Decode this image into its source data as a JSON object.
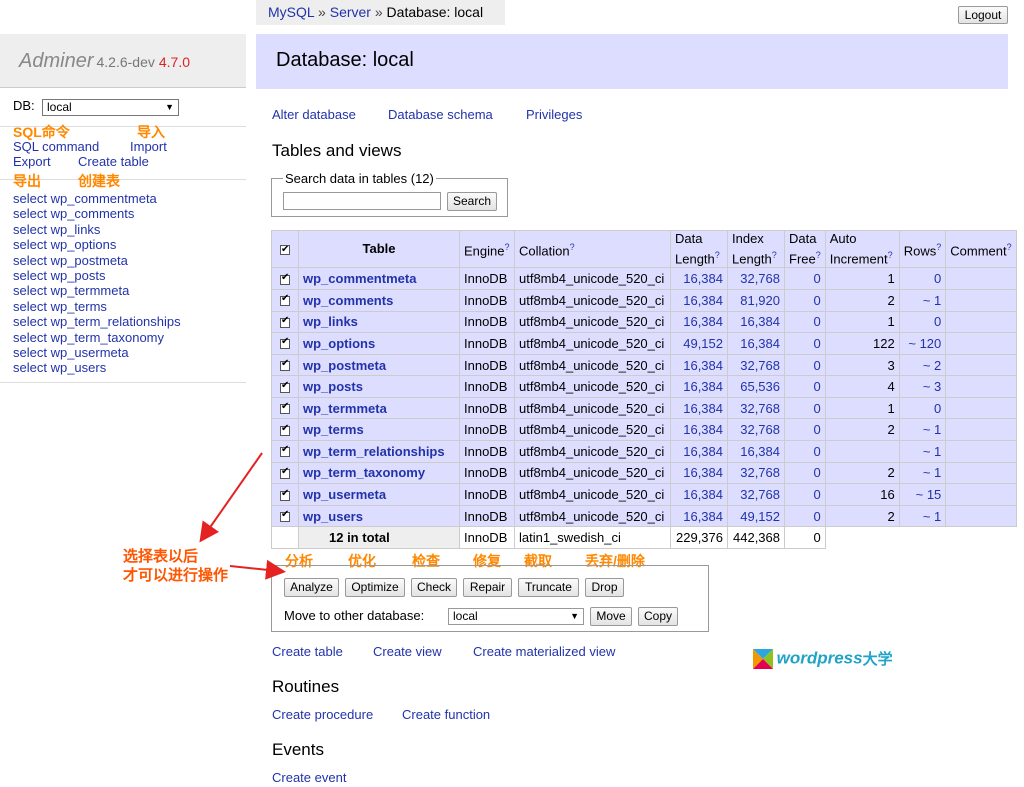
{
  "breadcrumb": {
    "mysql": "MySQL",
    "sep": "»",
    "server": "Server",
    "database": "Database: local"
  },
  "logout": "Logout",
  "sidebar": {
    "app_name": "Adminer",
    "version": "4.2.6-dev",
    "new_version": "4.7.0",
    "db_label": "DB:",
    "db_value": "local",
    "annotations": {
      "sql": "SQL命令",
      "import": "导入",
      "export": "导出",
      "create": "创建表"
    },
    "links": {
      "sql_command": "SQL command",
      "import": "Import",
      "export": "Export",
      "create_table": "Create table"
    },
    "tables": [
      "select wp_commentmeta",
      "select wp_comments",
      "select wp_links",
      "select wp_options",
      "select wp_postmeta",
      "select wp_posts",
      "select wp_termmeta",
      "select wp_terms",
      "select wp_term_relationships",
      "select wp_term_taxonomy",
      "select wp_usermeta",
      "select wp_users"
    ]
  },
  "header": {
    "title": "Database: local"
  },
  "links": {
    "alter": "Alter database",
    "schema": "Database schema",
    "privileges": "Privileges"
  },
  "section": {
    "tables_views": "Tables and views",
    "routines": "Routines",
    "events": "Events"
  },
  "search": {
    "legend": "Search data in tables (12)",
    "value": "",
    "button": "Search"
  },
  "table": {
    "headers": {
      "table": "Table",
      "engine": "Engine",
      "collation": "Collation",
      "data_length_1": "Data",
      "data_length_2": "Length",
      "index_length_1": "Index",
      "index_length_2": "Length",
      "data_free_1": "Data",
      "data_free_2": "Free",
      "auto_inc_1": "Auto",
      "auto_inc_2": "Increment",
      "rows": "Rows",
      "comment": "Comment",
      "q": "?"
    },
    "rows": [
      {
        "name": "wp_commentmeta",
        "engine": "InnoDB",
        "collation": "utf8mb4_unicode_520_ci",
        "data": "16,384",
        "index": "32,768",
        "free": "0",
        "auto": "1",
        "rows": "0"
      },
      {
        "name": "wp_comments",
        "engine": "InnoDB",
        "collation": "utf8mb4_unicode_520_ci",
        "data": "16,384",
        "index": "81,920",
        "free": "0",
        "auto": "2",
        "rows": "~ 1"
      },
      {
        "name": "wp_links",
        "engine": "InnoDB",
        "collation": "utf8mb4_unicode_520_ci",
        "data": "16,384",
        "index": "16,384",
        "free": "0",
        "auto": "1",
        "rows": "0"
      },
      {
        "name": "wp_options",
        "engine": "InnoDB",
        "collation": "utf8mb4_unicode_520_ci",
        "data": "49,152",
        "index": "16,384",
        "free": "0",
        "auto": "122",
        "rows": "~ 120"
      },
      {
        "name": "wp_postmeta",
        "engine": "InnoDB",
        "collation": "utf8mb4_unicode_520_ci",
        "data": "16,384",
        "index": "32,768",
        "free": "0",
        "auto": "3",
        "rows": "~ 2"
      },
      {
        "name": "wp_posts",
        "engine": "InnoDB",
        "collation": "utf8mb4_unicode_520_ci",
        "data": "16,384",
        "index": "65,536",
        "free": "0",
        "auto": "4",
        "rows": "~ 3"
      },
      {
        "name": "wp_termmeta",
        "engine": "InnoDB",
        "collation": "utf8mb4_unicode_520_ci",
        "data": "16,384",
        "index": "32,768",
        "free": "0",
        "auto": "1",
        "rows": "0"
      },
      {
        "name": "wp_terms",
        "engine": "InnoDB",
        "collation": "utf8mb4_unicode_520_ci",
        "data": "16,384",
        "index": "32,768",
        "free": "0",
        "auto": "2",
        "rows": "~ 1"
      },
      {
        "name": "wp_term_relationships",
        "engine": "InnoDB",
        "collation": "utf8mb4_unicode_520_ci",
        "data": "16,384",
        "index": "16,384",
        "free": "0",
        "auto": "",
        "rows": "~ 1"
      },
      {
        "name": "wp_term_taxonomy",
        "engine": "InnoDB",
        "collation": "utf8mb4_unicode_520_ci",
        "data": "16,384",
        "index": "32,768",
        "free": "0",
        "auto": "2",
        "rows": "~ 1"
      },
      {
        "name": "wp_usermeta",
        "engine": "InnoDB",
        "collation": "utf8mb4_unicode_520_ci",
        "data": "16,384",
        "index": "32,768",
        "free": "0",
        "auto": "16",
        "rows": "~ 15"
      },
      {
        "name": "wp_users",
        "engine": "InnoDB",
        "collation": "utf8mb4_unicode_520_ci",
        "data": "16,384",
        "index": "49,152",
        "free": "0",
        "auto": "2",
        "rows": "~ 1"
      }
    ],
    "total": {
      "label": "12 in total",
      "engine": "InnoDB",
      "collation": "latin1_swedish_ci",
      "data": "229,376",
      "index": "442,368",
      "free": "0"
    }
  },
  "actions": {
    "annotations": {
      "analyze": "分析",
      "optimize": "优化",
      "check": "检查",
      "repair": "修复",
      "truncate": "截取",
      "drop": "丢弃/删除"
    },
    "analyze": "Analyze",
    "optimize": "Optimize",
    "check": "Check",
    "repair": "Repair",
    "truncate": "Truncate",
    "drop": "Drop",
    "move_label": "Move to other database:",
    "move_db": "local",
    "move": "Move",
    "copy": "Copy"
  },
  "create_links": {
    "table": "Create table",
    "view": "Create view",
    "materialized": "Create materialized view"
  },
  "routines_links": {
    "procedure": "Create procedure",
    "function": "Create function"
  },
  "events_links": {
    "event": "Create event"
  },
  "watermark": {
    "brand": "wordpress",
    "suffix": "大学"
  },
  "annotation": {
    "line1": "选择表以后",
    "line2": "才可以进行操作"
  },
  "colors": {
    "accent_bg": "#ddddff",
    "link": "#2233aa",
    "annotation": "#ff8800",
    "arrow": "#e52222"
  }
}
